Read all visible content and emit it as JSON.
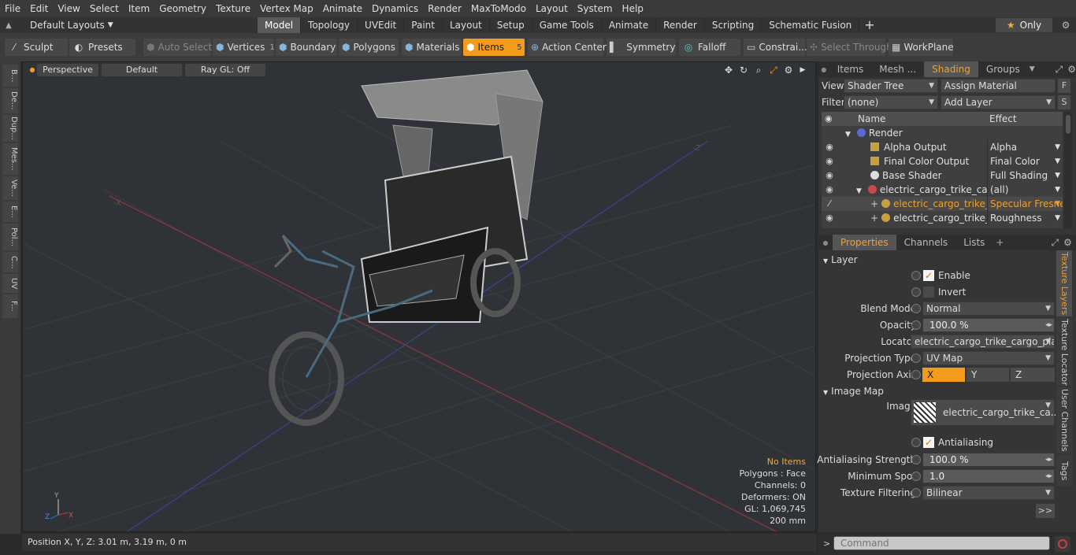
{
  "menu": [
    "File",
    "Edit",
    "View",
    "Select",
    "Item",
    "Geometry",
    "Texture",
    "Vertex Map",
    "Animate",
    "Dynamics",
    "Render",
    "MaxToModo",
    "Layout",
    "System",
    "Help"
  ],
  "layouts": {
    "label": "Default Layouts"
  },
  "tabs": [
    "Model",
    "Topology",
    "UVEdit",
    "Paint",
    "Layout",
    "Setup",
    "Game Tools",
    "Animate",
    "Render",
    "Scripting",
    "Schematic Fusion"
  ],
  "only_label": "Only",
  "toolbar": {
    "sculpt": "Sculpt",
    "presets": "Presets",
    "auto_select": "Auto Select",
    "vertices": "Vertices",
    "vertices_count": "1",
    "boundary": "Boundary",
    "polygons": "Polygons",
    "materials": "Materials",
    "items": "Items",
    "items_count": "5",
    "action_center": "Action Center",
    "symmetry": "Symmetry",
    "falloff": "Falloff",
    "constraints": "Constrai...",
    "select_through": "Select Through",
    "workplane": "WorkPlane"
  },
  "left_strip": [
    "B...",
    "De...",
    "Dup...",
    "Mes...",
    "Ve...",
    "E...",
    "Pol...",
    "C...",
    "UV",
    "F..."
  ],
  "viewport": {
    "perspective": "Perspective",
    "default": "Default",
    "raygl": "Ray GL: Off",
    "info": {
      "no_items": "No Items",
      "polygons": "Polygons : Face",
      "channels": "Channels: 0",
      "deformers": "Deformers: ON",
      "gl": "GL: 1,069,745",
      "scale": "200 mm"
    },
    "axis_labels": {
      "x": "X",
      "y": "Y",
      "z": "Z",
      "neg_x": "-X",
      "neg_z": "-Z"
    }
  },
  "status": {
    "position": "Position X, Y, Z:   3.01 m, 3.19 m, 0 m"
  },
  "right": {
    "top_tabs": [
      "Items",
      "Mesh ...",
      "Shading",
      "Groups"
    ],
    "view_label": "View",
    "view_value": "Shader Tree",
    "assign_material": "Assign Material",
    "f_btn": "F",
    "filter_label": "Filter",
    "filter_value": "(none)",
    "add_layer": "Add Layer",
    "s_btn": "S",
    "tree_header": {
      "name": "Name",
      "effect": "Effect"
    },
    "tree_rows": [
      {
        "name": "Render",
        "effect": ""
      },
      {
        "name": "Alpha Output",
        "effect": "Alpha"
      },
      {
        "name": "Final Color Output",
        "effect": "Final Color"
      },
      {
        "name": "Base Shader",
        "effect": "Full Shading"
      },
      {
        "name": "electric_cargo_trike_car ...",
        "effect": "(all)"
      },
      {
        "name": "electric_cargo_trike_c...",
        "effect": "Specular Fresnel"
      },
      {
        "name": "electric_cargo_trike_c...",
        "effect": "Roughness"
      }
    ],
    "prop_tabs": [
      "Properties",
      "Channels",
      "Lists"
    ],
    "layer_section": "Layer",
    "enable": "Enable",
    "invert": "Invert",
    "blend_mode_label": "Blend Mode",
    "blend_mode": "Normal",
    "opacity_label": "Opacity",
    "opacity": "100.0 %",
    "locator_label": "Locator",
    "locator": "electric_cargo_trike_cargo_plat...",
    "projection_type_label": "Projection Type",
    "projection_type": "UV Map",
    "projection_axis_label": "Projection Axis",
    "axis_x": "X",
    "axis_y": "Y",
    "axis_z": "Z",
    "image_map_section": "Image Map",
    "image_label": "Image",
    "image_value": "electric_cargo_trike_ca...",
    "antialiasing": "Antialiasing",
    "aa_strength_label": "Antialiasing Strength",
    "aa_strength": "100.0 %",
    "min_spot_label": "Minimum Spot",
    "min_spot": "1.0",
    "tex_filter_label": "Texture Filtering",
    "tex_filter": "Bilinear",
    "more_btn": ">>",
    "vertical_tabs": [
      "Texture Layers",
      "Texture Locator",
      "User Channels",
      "Tags"
    ],
    "command_placeholder": "Command"
  },
  "colors": {
    "accent": "#f39c1c",
    "highlight_text": "#f0a030",
    "viewport_bg": "#2f3236"
  }
}
